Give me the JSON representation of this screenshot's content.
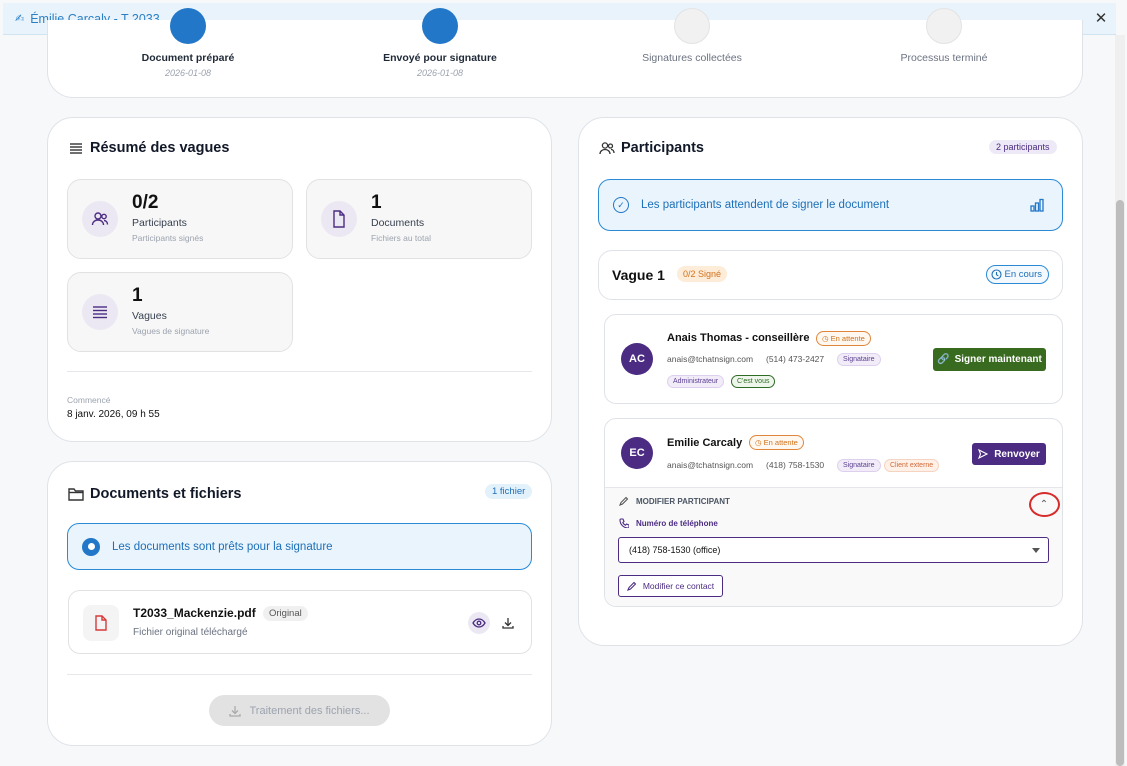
{
  "window": {
    "title": "Émilie Carcaly - T 2033"
  },
  "stepper": [
    {
      "label": "Document préparé",
      "date": "2026-01-08",
      "state": "done"
    },
    {
      "label": "Envoyé pour signature",
      "date": "2026-01-08",
      "state": "done"
    },
    {
      "label": "Signatures collectées",
      "date": "",
      "state": "todo"
    },
    {
      "label": "Processus terminé",
      "date": "",
      "state": "todo"
    }
  ],
  "summary": {
    "title": "Résumé des vagues",
    "stats": [
      {
        "value": "0/2",
        "name": "Participants",
        "sub": "Participants signés",
        "icon": "users-icon"
      },
      {
        "value": "1",
        "name": "Documents",
        "sub": "Fichiers au total",
        "icon": "document-icon"
      },
      {
        "value": "1",
        "name": "Vagues",
        "sub": "Vagues de signature",
        "icon": "layers-icon"
      }
    ],
    "started_label": "Commencé",
    "started_value": "8 janv. 2026, 09 h 55"
  },
  "documents": {
    "title": "Documents et fichiers",
    "badge": "1 fichier",
    "ready_msg": "Les documents sont prêts pour la signature",
    "file": {
      "name": "T2033_Mackenzie.pdf",
      "tag": "Original",
      "sub": "Fichier original téléchargé"
    },
    "process_button": "Traitement des fichiers..."
  },
  "participants": {
    "title": "Participants",
    "badge": "2 participants",
    "waiting_msg": "Les participants attendent de signer le document",
    "wave": {
      "title": "Vague 1",
      "signed": "0/2 Signé",
      "status": "En cours"
    },
    "people": [
      {
        "initials": "AC",
        "name": "Anais Thomas - conseillère",
        "status": "En attente",
        "email": "anais@tchatnsign.com",
        "phone": "(514) 473-2427",
        "role": "Signataire",
        "tags": [
          "Administrateur",
          "C'est vous"
        ],
        "action": "Signer maintenant"
      },
      {
        "initials": "EC",
        "name": "Emilie Carcaly",
        "status": "En attente",
        "email": "anais@tchatnsign.com",
        "phone": "(418) 758-1530",
        "role": "Signataire",
        "tags": [
          "Client externe"
        ],
        "action": "Renvoyer"
      }
    ],
    "edit": {
      "heading": "MODIFIER PARTICIPANT",
      "phone_label": "Numéro de téléphone",
      "phone_value": "(418) 758-1530 (office)",
      "edit_contact": "Modifier ce contact"
    }
  },
  "colors": {
    "primary_blue": "#2277c8",
    "purple": "#4b2c82",
    "green": "#386a1f",
    "orange": "#d1721c"
  }
}
